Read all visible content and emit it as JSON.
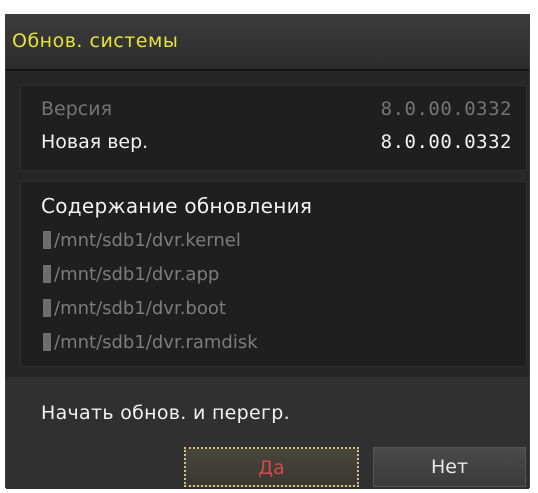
{
  "dialog": {
    "title": "Обнов. системы"
  },
  "version": {
    "current_label": "Версия",
    "current_value": "8.0.00.0332",
    "new_label": "Новая вер.",
    "new_value": "8.0.00.0332"
  },
  "content": {
    "heading": "Содержание обновления",
    "files": [
      "/mnt/sdb1/dvr.kernel",
      "/mnt/sdb1/dvr.app",
      "/mnt/sdb1/dvr.boot",
      "/mnt/sdb1/dvr.ramdisk"
    ]
  },
  "footer": {
    "action_text": "Начать обнов. и перегр.",
    "yes_label": "Да",
    "no_label": "Нет"
  },
  "colors": {
    "title": "#e7e03d",
    "yes_text": "#cf4a4a",
    "focus_border": "#d8c07a"
  }
}
